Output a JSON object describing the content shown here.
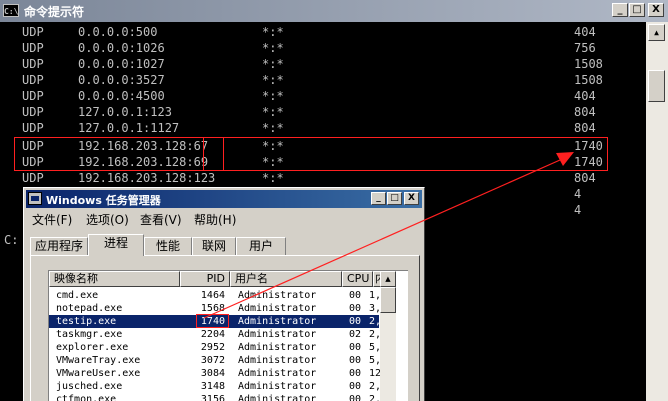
{
  "cmd": {
    "title": "命令提示符",
    "icon_label": "C:\\",
    "buttons": {
      "minimize": "_",
      "maximize": "□",
      "close": "X"
    },
    "rows": [
      {
        "proto": "UDP",
        "local": "0.0.0.0:500",
        "foreign": "*:*",
        "pid": "404"
      },
      {
        "proto": "UDP",
        "local": "0.0.0.0:1026",
        "foreign": "*:*",
        "pid": "756"
      },
      {
        "proto": "UDP",
        "local": "0.0.0.0:1027",
        "foreign": "*:*",
        "pid": "1508"
      },
      {
        "proto": "UDP",
        "local": "0.0.0.0:3527",
        "foreign": "*:*",
        "pid": "1508"
      },
      {
        "proto": "UDP",
        "local": "0.0.0.0:4500",
        "foreign": "*:*",
        "pid": "404"
      },
      {
        "proto": "UDP",
        "local": "127.0.0.1:123",
        "foreign": "*:*",
        "pid": "804"
      },
      {
        "proto": "UDP",
        "local": "127.0.0.1:1127",
        "foreign": "*:*",
        "pid": "804"
      },
      {
        "proto": "UDP",
        "local": "192.168.203.128:67",
        "foreign": "*:*",
        "pid": "1740"
      },
      {
        "proto": "UDP",
        "local": "192.168.203.128:69",
        "foreign": "*:*",
        "pid": "1740"
      },
      {
        "proto": "UDP",
        "local": "192.168.203.128:123",
        "foreign": "*:*",
        "pid": "804"
      },
      {
        "proto": "",
        "local": "",
        "foreign": "",
        "pid": "4"
      },
      {
        "proto": "",
        "local": "",
        "foreign": "",
        "pid": "4"
      }
    ],
    "prompt": "C:"
  },
  "taskmgr": {
    "title": "Windows 任务管理器",
    "buttons": {
      "minimize": "_",
      "maximize": "□",
      "close": "X"
    },
    "menu": [
      "文件(F)",
      "选项(O)",
      "查看(V)",
      "帮助(H)"
    ],
    "tabs": [
      "应用程序",
      "进程",
      "性能",
      "联网",
      "用户"
    ],
    "active_tab": "进程",
    "columns": [
      "映像名称",
      "PID",
      "用户名",
      "CPU",
      "内存"
    ],
    "processes": [
      {
        "name": "cmd.exe",
        "pid": "1464",
        "user": "Administrator",
        "cpu": "00",
        "mem": "1,"
      },
      {
        "name": "notepad.exe",
        "pid": "1568",
        "user": "Administrator",
        "cpu": "00",
        "mem": "3,"
      },
      {
        "name": "testip.exe",
        "pid": "1740",
        "user": "Administrator",
        "cpu": "00",
        "mem": "2,"
      },
      {
        "name": "taskmgr.exe",
        "pid": "2204",
        "user": "Administrator",
        "cpu": "02",
        "mem": "2,"
      },
      {
        "name": "explorer.exe",
        "pid": "2952",
        "user": "Administrator",
        "cpu": "00",
        "mem": "5,"
      },
      {
        "name": "VMwareTray.exe",
        "pid": "3072",
        "user": "Administrator",
        "cpu": "00",
        "mem": "5,"
      },
      {
        "name": "VMwareUser.exe",
        "pid": "3084",
        "user": "Administrator",
        "cpu": "00",
        "mem": "12,"
      },
      {
        "name": "jusched.exe",
        "pid": "3148",
        "user": "Administrator",
        "cpu": "00",
        "mem": "2,"
      },
      {
        "name": "ctfmon.exe",
        "pid": "3156",
        "user": "Administrator",
        "cpu": "00",
        "mem": "2,"
      }
    ],
    "selected_pid": "1740"
  },
  "colors": {
    "cmd_text": "#c0c0c0",
    "annotation_red": "#ff2020",
    "selection": "#0a246a"
  }
}
